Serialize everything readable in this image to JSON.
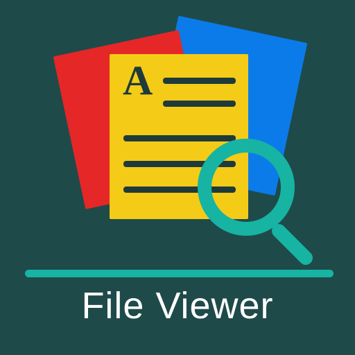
{
  "app": {
    "title": "File Viewer",
    "doc_letter": "A"
  },
  "colors": {
    "bg": "#1f4a4a",
    "accent": "#17b3a3",
    "red": "#e52727",
    "blue": "#0b7bea",
    "yellow": "#f4cb16",
    "ink": "#1e3a3a",
    "text": "#ffffff"
  },
  "icons": {
    "magnifier": "magnifier-icon",
    "document_stack": "document-stack-icon"
  }
}
